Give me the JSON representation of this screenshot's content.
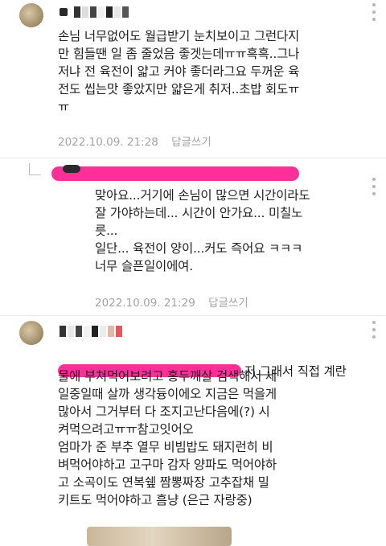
{
  "comments": [
    {
      "text": "손님 너무없어도 월급받기 눈치보이고 그런다지\n만 힘들땐 일 좀 줄었음 좋겟는데ㅠㅠ흑흑..그나\n저냐 전 육전이 얇고 커야 좋더라그요 두꺼운 육\n전도 씹는맛 좋았지만 얇은게 취저..초밥 회도ㅠ\nㅠ",
      "timestamp": "2022.10.09. 21:28",
      "reply_label": "답글쓰기"
    },
    {
      "text": "맞아요...거기에 손님이 많으면 시간이라도\n잘 가야하는데... 시간이 안가요... 미칠노\n릇...\n일단... 육전이 양이...커도 즉어요 ㅋㅋㅋ\n너무 슬픈일이에여.",
      "timestamp": "2022.10.09. 21:29",
      "reply_label": "답글쓰기"
    },
    {
      "first_line_tail": "저 그래서 직접 계란",
      "text": "물에 부쳐먹어보려고 홍두깨살 검색해서 세\n일중일때 살까 생각듕이에오 지금은 먹을게\n많아서 그거부터 다 조지고난다음에(?) 시\n켜먹으려고ㅠㅠ참고잇어오\n엄마가 준 부추 열무 비빔밥도 돼지런히 비\n벼먹어야하고 고구마 감자 양파도 먹어야하\n고 소곡이도 연복쉪 짬뽕짜장 고추잡채 밀\n키트도 먹어야하고 흠냥 (은근 자랑중)"
    }
  ],
  "icons": {
    "more": "more-vertical-icon",
    "reply_arrow": "reply-arrow-icon"
  },
  "colors": {
    "redaction_pink": "#ff2f9a",
    "meta_gray": "#a3a3a3"
  }
}
